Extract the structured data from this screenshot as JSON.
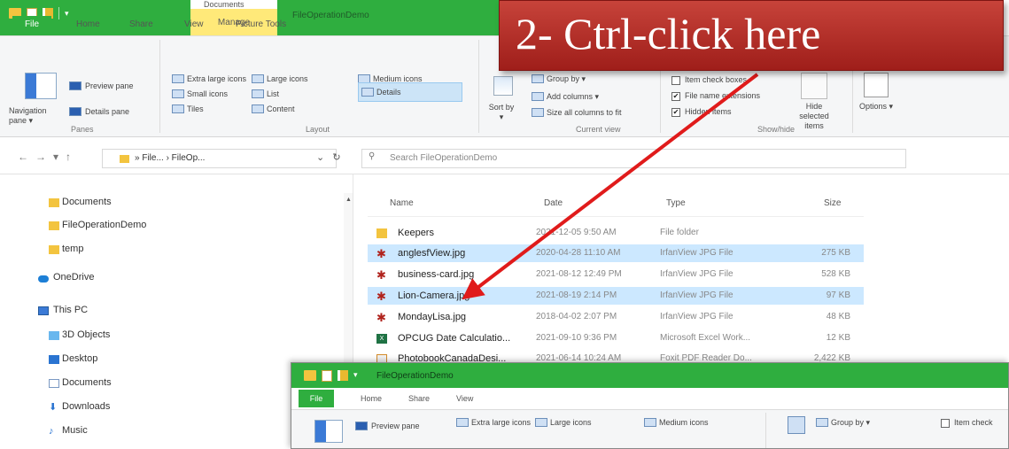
{
  "banner": {
    "text": "2- Ctrl-click here"
  },
  "window": {
    "title": "FileOperationDemo",
    "manage_label": "Manage",
    "tabs": [
      "File",
      "Home",
      "Share",
      "View",
      "Picture Tools"
    ],
    "top_cut_text": "Documents"
  },
  "ribbon": {
    "panes": {
      "navigation_pane": "Navigation pane ▾",
      "preview_pane": "Preview pane",
      "details_pane": "Details pane",
      "label": "Panes"
    },
    "layout": {
      "extra_large": "Extra large icons",
      "large": "Large icons",
      "medium": "Medium icons",
      "small": "Small icons",
      "list": "List",
      "details": "Details",
      "tiles": "Tiles",
      "content": "Content",
      "label": "Layout"
    },
    "current_view": {
      "group_by": "Group by ▾",
      "add_columns": "Add columns ▾",
      "size_all": "Size all columns to fit",
      "sort_by": "Sort by ▾",
      "label": "Current view"
    },
    "show_hide": {
      "item_checkboxes": "Item check boxes",
      "file_name_ext": "File name extensions",
      "hidden_items": "Hidden items",
      "hide_selected": "Hide selected items",
      "label": "Show/hide"
    },
    "options": "Options ▾"
  },
  "address": {
    "path": "» File... › FileOp...",
    "search_placeholder": "Search FileOperationDemo"
  },
  "sidebar": {
    "items": [
      {
        "label": "Documents",
        "icon": "folder-icon"
      },
      {
        "label": "FileOperationDemo",
        "icon": "folder-icon"
      },
      {
        "label": "temp",
        "icon": "folder-icon"
      },
      {
        "label": "OneDrive",
        "icon": "cloud-icon"
      },
      {
        "label": "This PC",
        "icon": "computer-icon"
      },
      {
        "label": "3D Objects",
        "icon": "cube-icon"
      },
      {
        "label": "Desktop",
        "icon": "desktop-icon"
      },
      {
        "label": "Documents",
        "icon": "document-icon"
      },
      {
        "label": "Downloads",
        "icon": "download-icon"
      },
      {
        "label": "Music",
        "icon": "music-icon"
      }
    ]
  },
  "files": {
    "columns": [
      "Name",
      "Date",
      "Type",
      "Size"
    ],
    "rows": [
      {
        "name": "Keepers",
        "date": "2021-12-05 9:50 AM",
        "type": "File folder",
        "size": "",
        "icon": "folder-icon",
        "selected": false
      },
      {
        "name": "anglesfView.jpg",
        "date": "2020-04-28 11:10 AM",
        "type": "IrfanView JPG File",
        "size": "275 KB",
        "icon": "irfanview-icon",
        "selected": true
      },
      {
        "name": "business-card.jpg",
        "date": "2021-08-12 12:49 PM",
        "type": "IrfanView JPG File",
        "size": "528 KB",
        "icon": "irfanview-icon",
        "selected": false
      },
      {
        "name": "Lion-Camera.jpg",
        "date": "2021-08-19 2:14 PM",
        "type": "IrfanView JPG File",
        "size": "97 KB",
        "icon": "irfanview-icon",
        "selected": true
      },
      {
        "name": "MondayLisa.jpg",
        "date": "2018-04-02 2:07 PM",
        "type": "IrfanView JPG File",
        "size": "48 KB",
        "icon": "irfanview-icon",
        "selected": false
      },
      {
        "name": "OPCUG Date Calculatio...",
        "date": "2021-09-10 9:36 PM",
        "type": "Microsoft Excel Work...",
        "size": "12 KB",
        "icon": "excel-icon",
        "selected": false
      },
      {
        "name": "PhotobookCanadaDesi...",
        "date": "2021-06-14 10:24 AM",
        "type": "Foxit PDF Reader Do...",
        "size": "2,422 KB",
        "icon": "pdf-icon",
        "selected": false
      }
    ]
  },
  "window2": {
    "title": "FileOperationDemo",
    "tabs": [
      "File",
      "Home",
      "Share",
      "View"
    ],
    "ribbon": {
      "preview_pane": "Preview pane",
      "extra_large": "Extra large icons",
      "large": "Large icons",
      "medium": "Medium icons",
      "group_by": "Group by ▾",
      "item_check": "Item check"
    }
  }
}
